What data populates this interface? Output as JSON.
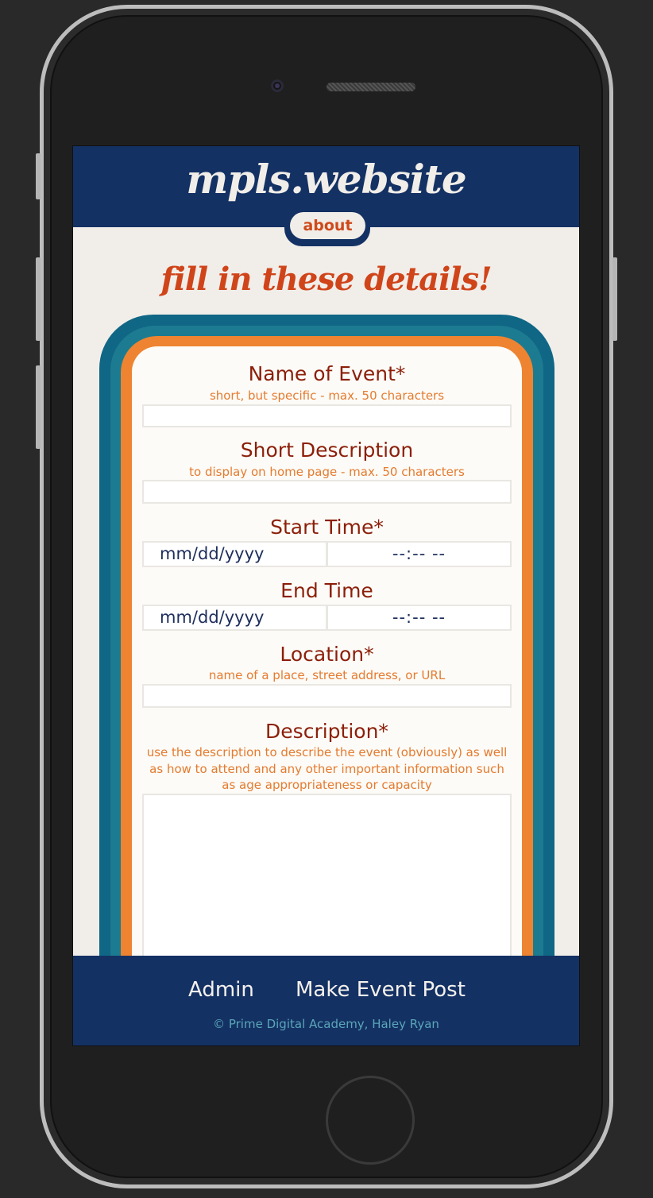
{
  "header": {
    "brand": "mpls.website",
    "about_label": "about"
  },
  "page": {
    "title": "fill in these details!"
  },
  "form": {
    "name": {
      "label": "Name of Event*",
      "hint": "short, but specific - max. 50 characters",
      "value": ""
    },
    "short_description": {
      "label": "Short Description",
      "hint": "to display on home page - max. 50 characters",
      "value": ""
    },
    "start_time": {
      "label": "Start Time*",
      "date_placeholder": "mm/dd/yyyy",
      "time_placeholder": "--:-- --"
    },
    "end_time": {
      "label": "End Time",
      "date_placeholder": "mm/dd/yyyy",
      "time_placeholder": "--:-- --"
    },
    "location": {
      "label": "Location*",
      "hint": "name of a place, street address, or URL",
      "value": ""
    },
    "description": {
      "label": "Description*",
      "hint": "use the description to describe the event (obviously) as well as how to attend and any other important information such as age appropriateness or capacity",
      "value": ""
    }
  },
  "footer": {
    "admin_label": "Admin",
    "make_post_label": "Make Event Post",
    "copyright": "© Prime Digital Academy, Haley Ryan"
  },
  "colors": {
    "navy": "#143164",
    "cream": "#f1eee9",
    "title_orange": "#d0441a",
    "label_red": "#8c1f0a",
    "hint_orange": "#e57b2f",
    "arch_teal_dark": "#106685",
    "arch_teal": "#1c7b90",
    "arch_orange": "#ee8431"
  }
}
